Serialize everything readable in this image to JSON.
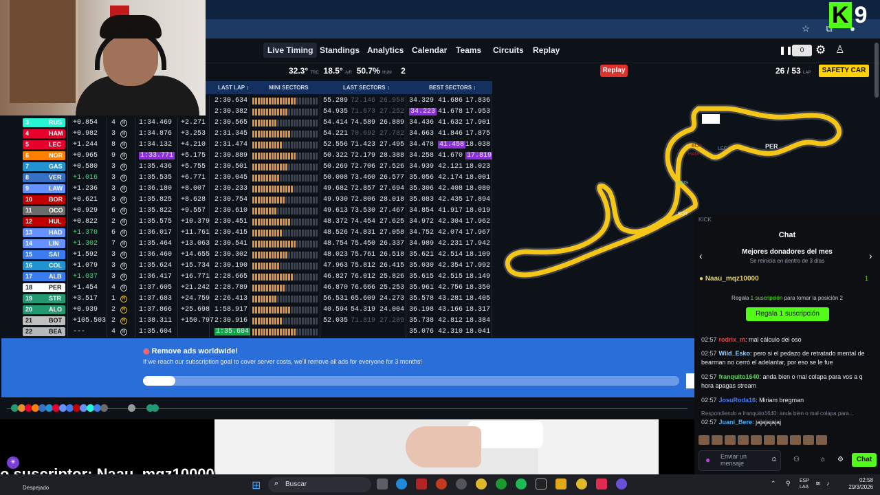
{
  "brand": {
    "logo_letter": "K",
    "logo_number": "9"
  },
  "nav": {
    "items": [
      "Live Timing",
      "Standings",
      "Analytics",
      "Calendar",
      "Teams",
      "Circuits",
      "Replay"
    ],
    "counter": "0"
  },
  "status": {
    "track_temp": "32.3°",
    "track_label": "TRC",
    "air_temp": "18.5°",
    "air_label": "AIR",
    "humidity": "50.7%",
    "humidity_label": "HUM",
    "wind": "2",
    "replay_label": "Replay",
    "lap": "26 / 53",
    "lap_label": "LAP",
    "safety_car": "SAFETY CAR"
  },
  "table": {
    "headers": {
      "last_lap": "LAST LAP ↕",
      "mini_sectors": "MINI SECTORS",
      "last_sectors": "LAST SECTORS ↕",
      "best_sectors": "BEST SECTORS ↕"
    },
    "pre_rows": [
      {
        "last": "2:30.634",
        "ls": [
          "55.289",
          "72.146",
          "26.958"
        ],
        "bs": [
          "34.329",
          "41.686",
          "17.836"
        ]
      },
      {
        "last": "2:30.382",
        "ls": [
          "54.935",
          "71.673",
          "27.252"
        ],
        "bs": [
          "34.223",
          "41.678",
          "17.953"
        ]
      }
    ],
    "rows": [
      {
        "pos": "3",
        "code": "RUS",
        "color": "#27f4d2",
        "gap": "+0.854",
        "pits": "4",
        "tyre": "H",
        "best": "1:34.469",
        "int": "+2.271",
        "last": "2:30.565",
        "ls": [
          "54.414",
          "74.589",
          "26.889"
        ],
        "bs": [
          "34.436",
          "41.632",
          "17.901"
        ]
      },
      {
        "pos": "4",
        "code": "HAM",
        "color": "#e8002d",
        "gap": "+0.982",
        "pits": "3",
        "tyre": "H",
        "best": "1:34.876",
        "int": "+3.253",
        "last": "2:31.345",
        "ls": [
          "54.221",
          "70.692",
          "27.782"
        ],
        "bs": [
          "34.663",
          "41.846",
          "17.875"
        ]
      },
      {
        "pos": "5",
        "code": "LEC",
        "color": "#e8002d",
        "gap": "+1.244",
        "pits": "8",
        "tyre": "H",
        "best": "1:34.132",
        "int": "+4.210",
        "last": "2:31.474",
        "ls": [
          "52.556",
          "71.423",
          "27.495"
        ],
        "bs": [
          "34.478",
          "41.458",
          "18.038"
        ]
      },
      {
        "pos": "6",
        "code": "NOR",
        "color": "#ff8000",
        "gap": "+0.965",
        "pits": "9",
        "tyre": "H",
        "best": "1:33.771",
        "int": "+5.175",
        "last": "2:30.889",
        "ls": [
          "50.322",
          "72.179",
          "28.388"
        ],
        "bs": [
          "34.258",
          "41.670",
          "17.819"
        ]
      },
      {
        "pos": "7",
        "code": "GAS",
        "color": "#2293d1",
        "gap": "+0.580",
        "pits": "3",
        "tyre": "H",
        "best": "1:35.436",
        "int": "+5.755",
        "last": "2:30.501",
        "ls": [
          "50.269",
          "72.706",
          "27.526"
        ],
        "bs": [
          "34.939",
          "42.121",
          "18.023"
        ]
      },
      {
        "pos": "8",
        "code": "VER",
        "color": "#3671c6",
        "gap": "+1.016",
        "pits": "3",
        "tyre": "H",
        "best": "1:35.535",
        "int": "+6.771",
        "last": "2:30.045",
        "ls": [
          "50.008",
          "73.460",
          "26.577"
        ],
        "bs": [
          "35.056",
          "42.174",
          "18.001"
        ]
      },
      {
        "pos": "9",
        "code": "LAW",
        "color": "#6692ff",
        "gap": "+1.236",
        "pits": "3",
        "tyre": "H",
        "best": "1:36.180",
        "int": "+8.007",
        "last": "2:30.233",
        "ls": [
          "49.682",
          "72.857",
          "27.694"
        ],
        "bs": [
          "35.306",
          "42.408",
          "18.080"
        ]
      },
      {
        "pos": "10",
        "code": "BOR",
        "color": "#c00000",
        "gap": "+0.621",
        "pits": "3",
        "tyre": "H",
        "best": "1:35.825",
        "int": "+8.628",
        "last": "2:30.754",
        "ls": [
          "49.930",
          "72.806",
          "28.018"
        ],
        "bs": [
          "35.083",
          "42.435",
          "17.894"
        ]
      },
      {
        "pos": "11",
        "code": "OCO",
        "color": "#6b6b6b",
        "gap": "+0.929",
        "pits": "6",
        "tyre": "H",
        "best": "1:35.822",
        "int": "+9.557",
        "last": "2:30.610",
        "ls": [
          "49.613",
          "73.530",
          "27.467"
        ],
        "bs": [
          "34.854",
          "41.917",
          "18.019"
        ]
      },
      {
        "pos": "12",
        "code": "HUL",
        "color": "#c00000",
        "gap": "+0.822",
        "pits": "2",
        "tyre": "H",
        "best": "1:35.575",
        "int": "+10.379",
        "last": "2:30.451",
        "ls": [
          "48.372",
          "74.454",
          "27.625"
        ],
        "bs": [
          "34.972",
          "42.304",
          "17.962"
        ]
      },
      {
        "pos": "13",
        "code": "HAD",
        "color": "#6692ff",
        "gap": "+1.370",
        "pits": "6",
        "tyre": "H",
        "best": "1:36.017",
        "int": "+11.761",
        "last": "2:30.415",
        "ls": [
          "48.526",
          "74.831",
          "27.058"
        ],
        "bs": [
          "34.752",
          "42.074",
          "17.967"
        ]
      },
      {
        "pos": "14",
        "code": "LIN",
        "color": "#6692ff",
        "gap": "+1.302",
        "pits": "7",
        "tyre": "H",
        "best": "1:35.464",
        "int": "+13.063",
        "last": "2:30.541",
        "ls": [
          "48.754",
          "75.450",
          "26.337"
        ],
        "bs": [
          "34.989",
          "42.231",
          "17.942"
        ]
      },
      {
        "pos": "15",
        "code": "SAI",
        "color": "#3b7df0",
        "gap": "+1.592",
        "pits": "3",
        "tyre": "H",
        "best": "1:36.460",
        "int": "+14.655",
        "last": "2:30.302",
        "ls": [
          "48.023",
          "75.761",
          "26.518"
        ],
        "bs": [
          "35.621",
          "42.514",
          "18.109"
        ]
      },
      {
        "pos": "16",
        "code": "COL",
        "color": "#2293d1",
        "gap": "+1.079",
        "pits": "3",
        "tyre": "H",
        "best": "1:35.624",
        "int": "+15.734",
        "last": "2:30.190",
        "ls": [
          "47.963",
          "75.812",
          "26.415"
        ],
        "bs": [
          "35.030",
          "42.354",
          "17.992"
        ]
      },
      {
        "pos": "17",
        "code": "ALB",
        "color": "#3b7df0",
        "gap": "+1.037",
        "pits": "3",
        "tyre": "H",
        "best": "1:36.417",
        "int": "+16.771",
        "last": "2:28.665",
        "ls": [
          "46.827",
          "76.012",
          "25.826"
        ],
        "bs": [
          "35.615",
          "42.515",
          "18.149"
        ]
      },
      {
        "pos": "18",
        "code": "PER",
        "color": "#ffffff",
        "gap": "+1.454",
        "pits": "4",
        "tyre": "H",
        "best": "1:37.605",
        "int": "+21.242",
        "last": "2:28.789",
        "ls": [
          "46.870",
          "76.666",
          "25.253"
        ],
        "bs": [
          "35.961",
          "42.756",
          "18.350"
        ]
      },
      {
        "pos": "19",
        "code": "STR",
        "color": "#229971",
        "gap": "+3.517",
        "pits": "1",
        "tyre": "M",
        "best": "1:37.683",
        "int": "+24.759",
        "last": "2:26.413",
        "ls": [
          "56.531",
          "65.609",
          "24.273"
        ],
        "bs": [
          "35.578",
          "43.281",
          "18.405"
        ]
      },
      {
        "pos": "20",
        "code": "ALO",
        "color": "#229971",
        "gap": "+0.939",
        "pits": "2",
        "tyre": "M",
        "best": "1:37.866",
        "int": "+25.698",
        "last": "1:58.917",
        "ls": [
          "40.594",
          "54.319",
          "24.004"
        ],
        "bs": [
          "36.198",
          "43.166",
          "18.317"
        ]
      },
      {
        "pos": "21",
        "code": "BOT",
        "color": "#c0c0c0",
        "gap": "+105.503",
        "pits": "2",
        "tyre": "M",
        "best": "1:38.311",
        "int": "+150.797",
        "last": "2:30.916",
        "ls": [
          "52.035",
          "71.819",
          "27.289"
        ],
        "bs": [
          "35.738",
          "42.812",
          "18.384"
        ]
      },
      {
        "pos": "22",
        "code": "BEA",
        "color": "#b6babd",
        "gap": "---",
        "pits": "4",
        "tyre": "H",
        "best": "1:35.604",
        "int": "",
        "last": "1:35.604",
        "ls": [
          "",
          "",
          ""
        ],
        "bs": [
          "35.076",
          "42.310",
          "18.041"
        ]
      }
    ]
  },
  "track": {
    "labels": [
      "PER",
      "RUS",
      "BOT",
      "BOR",
      "HAM",
      "LEC"
    ]
  },
  "chat": {
    "platform": "KICK",
    "title": "Chat",
    "donors_title": "Mejores donadores del mes",
    "donors_sub": "Se reinicia en dentro de 3 días",
    "top_donor": "Naau_mqz10000",
    "top_donor_count": "1",
    "gift_text_pre": "Regala",
    "gift_text_link": "1 suscripción",
    "gift_text_post": "para tomar la posición 2",
    "gift_button": "Regala 1 suscripción",
    "messages": [
      {
        "time": "02:57",
        "user": "rodrix_m",
        "text": ": mal cálculo del oso"
      },
      {
        "time": "02:57",
        "user": "Wild_Esko",
        "text": ": pero si el pedazo de retratado mental de bearman no cerró el adelantar, por eso se le fue"
      },
      {
        "time": "02:57",
        "user": "franquito1640",
        "text": ": anda bien o mal colapa para vos a q hora apagas stream"
      },
      {
        "time": "02:57",
        "user": "JosuRoda16",
        "text": ": Miriam bregman"
      },
      {
        "time": "02:57",
        "user": "Juani_Bere",
        "text": ": jajajajajaj"
      }
    ],
    "reply_note": "Respondiendo a franquito1640: anda bien o mal colapa para...",
    "input_placeholder": "Enviar un mensaje",
    "chat_button": "Chat"
  },
  "ad": {
    "title": "Remove ads worldwide!",
    "subtitle": "If we reach our subscription goal to cover server costs, we'll remove all ads for everyone for 3 months!",
    "progress": 0.06
  },
  "overlay": {
    "subscriber": "o suscriptor: Naau_mqz10000",
    "weather_caption": "Despejado"
  },
  "taskbar": {
    "search": "Buscar",
    "lang": "ESP",
    "lang2": "LAA",
    "time": "02:58",
    "date": "29/3/2026"
  }
}
